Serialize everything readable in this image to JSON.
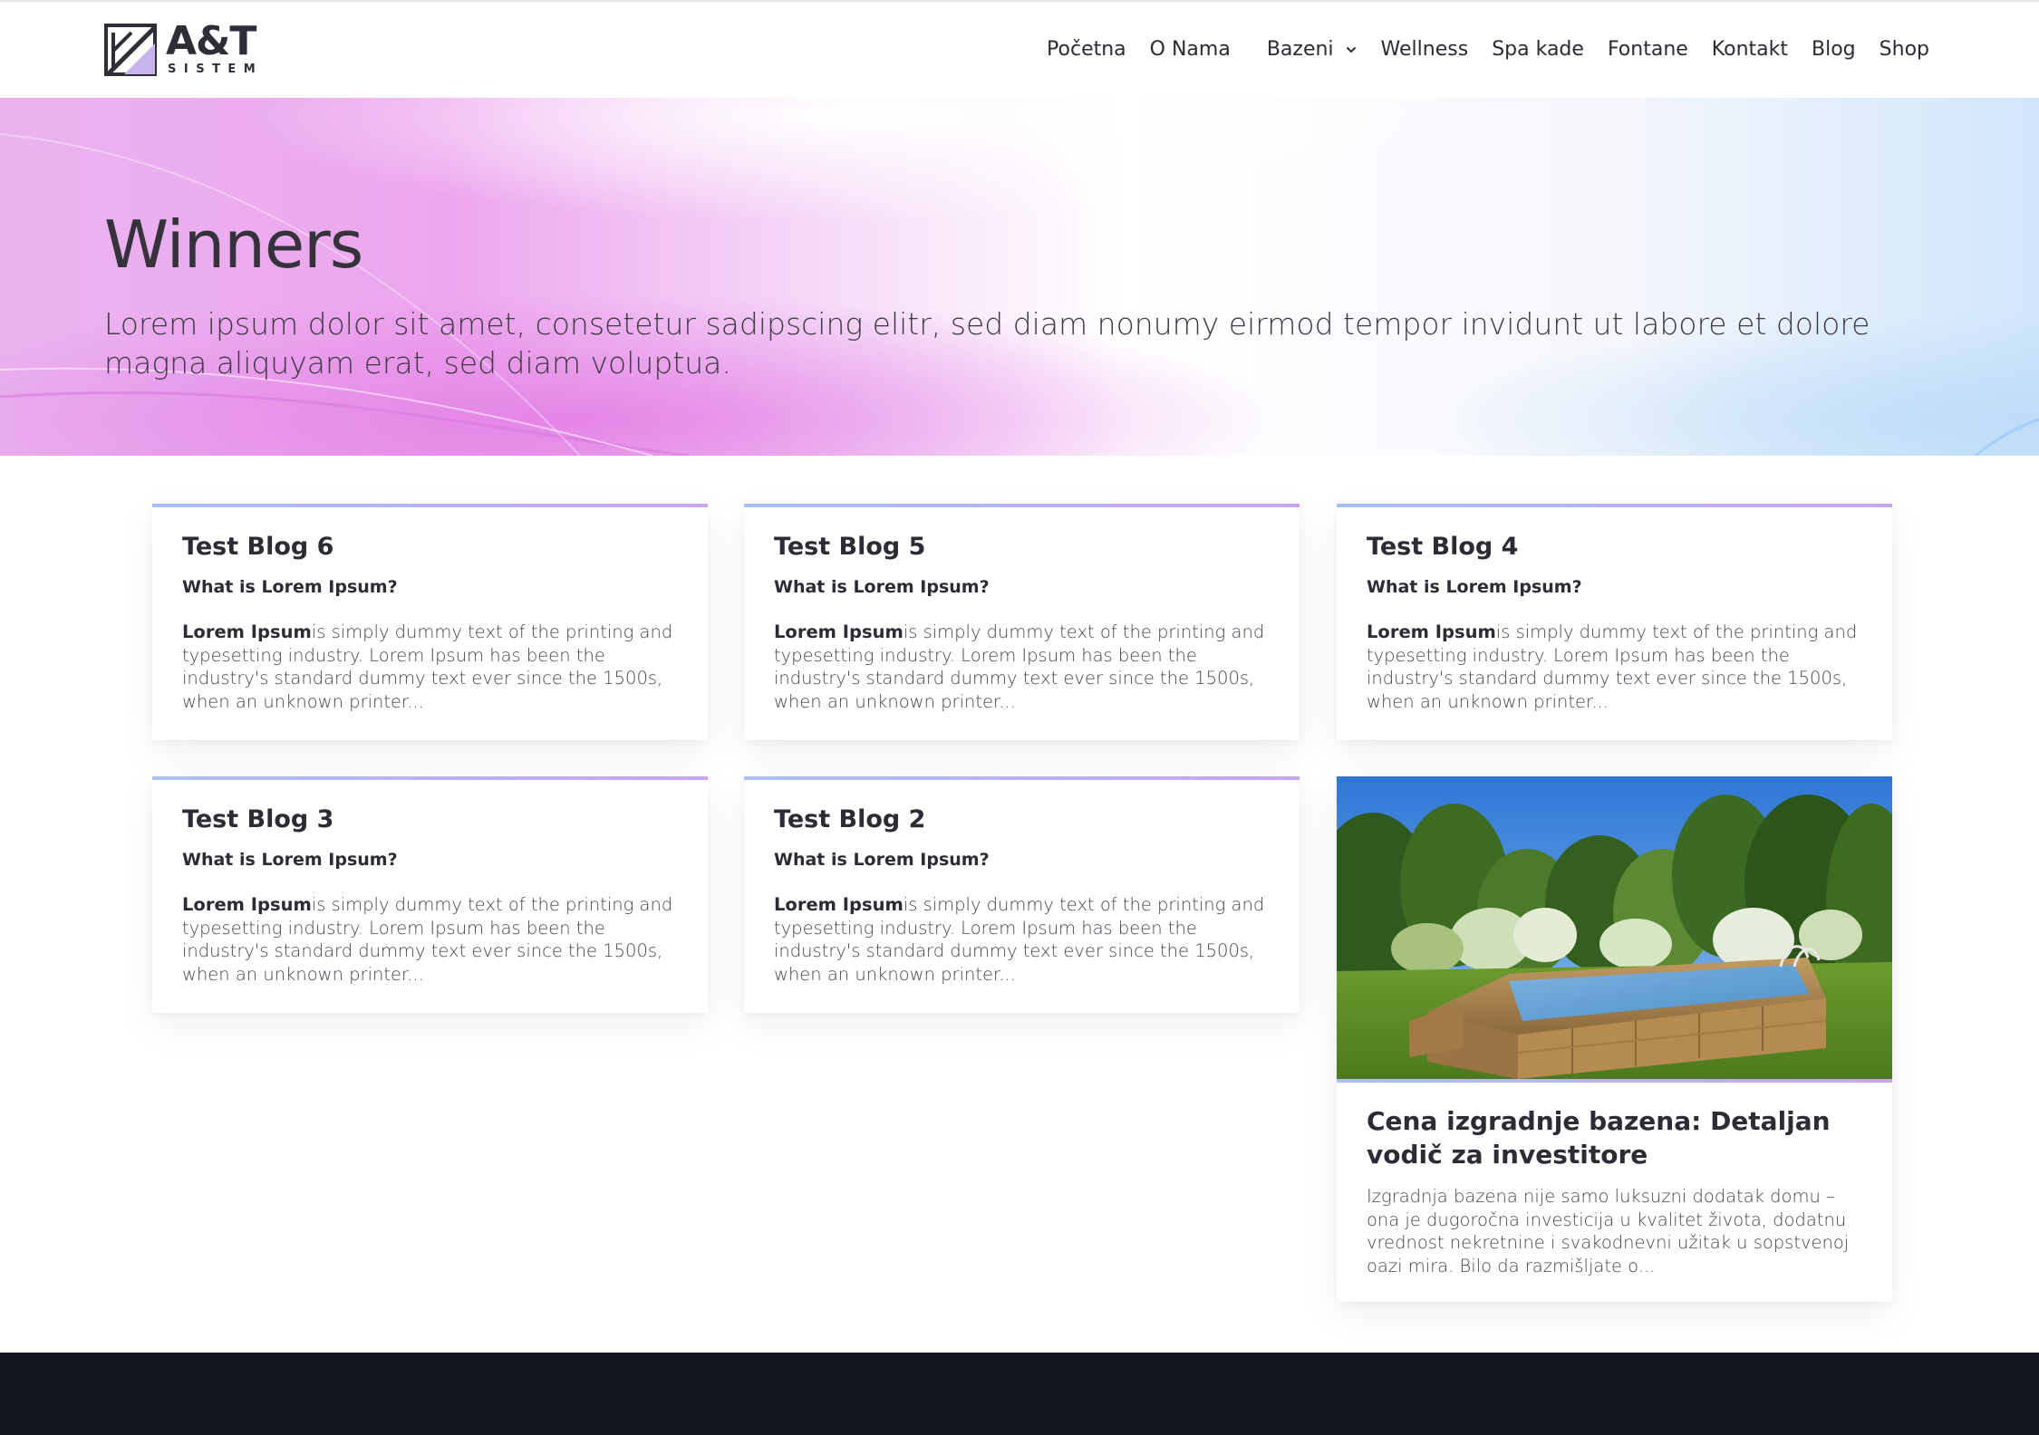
{
  "brand": {
    "logo_text": "A&T",
    "logo_sub": "SISTEM"
  },
  "nav": {
    "items": [
      "Početna",
      "O Nama",
      "Bazeni",
      "Wellness",
      "Spa kade",
      "Fontane",
      "Kontakt",
      "Blog",
      "Shop"
    ]
  },
  "hero": {
    "title": "Winners",
    "text": "Lorem ipsum dolor sit amet, consetetur sadipscing elitr, sed diam nonumy eirmod tempor invidunt ut labore et dolore magna aliquyam erat, sed diam voluptua."
  },
  "posts": [
    {
      "title": "Test Blog 6",
      "subtitle": "What is Lorem Ipsum?",
      "lead": "Lorem Ipsum",
      "excerpt": "is simply dummy text of the printing and typesetting industry. Lorem Ipsum has been the industry's standard dummy text ever since the 1500s, when an unknown printer..."
    },
    {
      "title": "Test Blog 5",
      "subtitle": "What is Lorem Ipsum?",
      "lead": "Lorem Ipsum",
      "excerpt": "is simply dummy text of the printing and typesetting industry. Lorem Ipsum has been the industry's standard dummy text ever since the 1500s, when an unknown printer..."
    },
    {
      "title": "Test Blog 4",
      "subtitle": "What is Lorem Ipsum?",
      "lead": "Lorem Ipsum",
      "excerpt": "is simply dummy text of the printing and typesetting industry. Lorem Ipsum has been the industry's standard dummy text ever since the 1500s, when an unknown printer..."
    },
    {
      "title": "Test Blog 3",
      "subtitle": "What is Lorem Ipsum?",
      "lead": "Lorem Ipsum",
      "excerpt": "is simply dummy text of the printing and typesetting industry. Lorem Ipsum has been the industry's standard dummy text ever since the 1500s, when an unknown printer..."
    },
    {
      "title": "Test Blog 2",
      "subtitle": "What is Lorem Ipsum?",
      "lead": "Lorem Ipsum",
      "excerpt": "is simply dummy text of the printing and typesetting industry. Lorem Ipsum has been the industry's standard dummy text ever since the 1500s, when an unknown printer..."
    }
  ],
  "featured_post": {
    "title": "Cena izgradnje bazena: Detaljan vodič za investitore",
    "excerpt": "Izgradnja bazena nije samo luksuzni dodatak domu – ona je dugoročna investicija u kvalitet života, dodatnu vrednost nekretnine i svakodnevni užitak u sopstvenoj oazi mira. Bilo da razmišljate o...",
    "image": "wooden-above-ground-pool-in-garden"
  },
  "colors": {
    "accent_gradient_start": "#a9bff0",
    "accent_gradient_end": "#c9a6ec",
    "hero_pink": "#e68ae8",
    "hero_blue": "#cfe6fb",
    "footer_bg": "#12151c",
    "text_dark": "#2d2b33"
  },
  "icons": {
    "logo": "at-sistem-logo-mark",
    "dropdown": "chevron-down-icon"
  }
}
